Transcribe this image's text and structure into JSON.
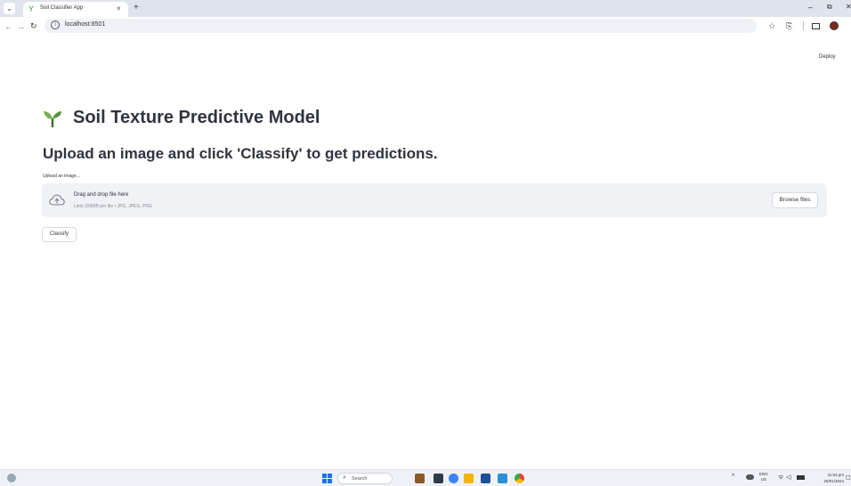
{
  "browser": {
    "tab_title": "Soil Classifier App",
    "tab_close": "×",
    "new_tab": "+",
    "url": "localhost:8501",
    "window_min": "–",
    "window_restore": "⧉",
    "window_close": "✕"
  },
  "app": {
    "deploy_label": "Deploy",
    "title": "Soil Texture Predictive Model",
    "subtitle": "Upload an image and click 'Classify' to get predictions.",
    "uploader": {
      "label": "Upload an image...",
      "drop_text": "Drag and drop file here",
      "limit_text": "Limit 200MB per file • JPG, JPEG, PNG",
      "browse_label": "Browse files"
    },
    "classify_label": "Classify"
  },
  "taskbar": {
    "search_label": "Search",
    "lang_line1": "ENG",
    "lang_line2": "US",
    "time": "11:53 pm",
    "date": "26/01/2024"
  },
  "colors": {
    "accent_red": "#ff4b4b",
    "accent_orange": "#ffbd45",
    "dropzone_bg": "#f0f2f6",
    "text": "#31333f"
  }
}
